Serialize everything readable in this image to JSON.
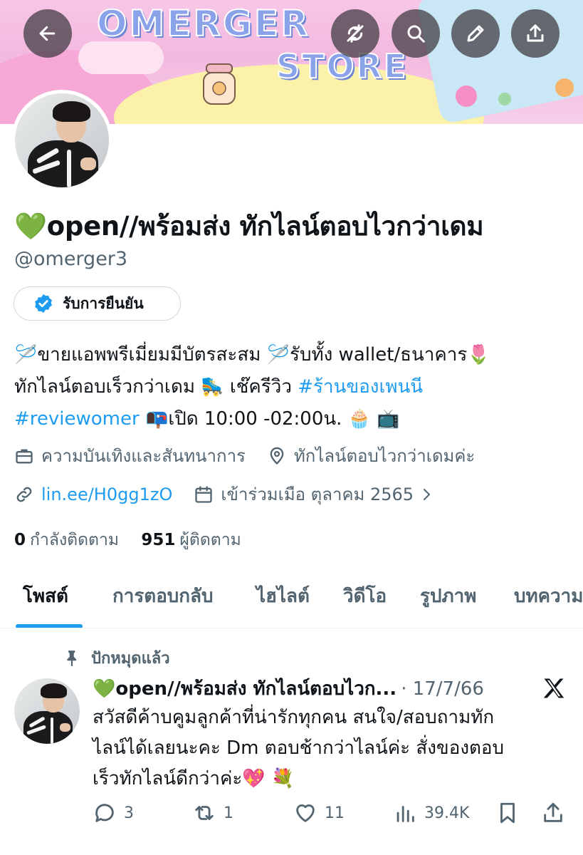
{
  "banner": {
    "title_line1": "OMERGER",
    "title_line2": "STORE"
  },
  "header_icons": {
    "back": "back-arrow-icon",
    "sync": "no-sync-icon",
    "search": "search-icon",
    "edit": "pencil-icon",
    "share": "share-icon"
  },
  "profile": {
    "display_name": "open//พร้อมส่ง ทักไลน์ตอบไวกว่าเดม",
    "name_emoji": "💚",
    "handle": "@omerger3",
    "verified_label": "รับการยืนยัน",
    "bio": {
      "line1_a": "ขายแอพพรีเมี่ยมมีบัตรสะสม ",
      "line1_b": "รับทั้ง wallet/ธนาคาร",
      "line1_emoji_needle": "🪡",
      "line1_emoji_tulip": "🌷",
      "line2_a": "ทักไลน์ตอบเร็วกว่าเดม ",
      "line2_emoji_skate": "🛼",
      "line2_b": " เช๊ครีวิว ",
      "line2_hashtag": "#ร้านของเพนนี",
      "line3_hashtag": "#reviewomer",
      "line3_emoji_mailbox": "📭",
      "line3_b": "เปิด 10:00 -02:00น. ",
      "line3_emoji_cupcake": "🧁",
      "line3_emoji_tv": "📺"
    },
    "category": "ความบันเทิงและสันทนาการ",
    "location": "ทักไลน์ตอบไวกว่าเดมค่ะ",
    "website": "lin.ee/H0gg1zO",
    "joined": "เข้าร่วมเมือ ตุลาคม 2565",
    "following_count": "0",
    "following_label": "กำลังติดตาม",
    "followers_count": "951",
    "followers_label": "ผู้ติดตาม"
  },
  "tabs": [
    {
      "label": "โพสต์",
      "active": true
    },
    {
      "label": "การตอบกลับ"
    },
    {
      "label": "ไฮไลต์"
    },
    {
      "label": "วิดีโอ"
    },
    {
      "label": "รูปภาพ"
    },
    {
      "label": "บทความ"
    }
  ],
  "pinned_post": {
    "pinned_label": "ปักหมุดแล้ว",
    "author": "open//พร้อมส่ง ทักไลน์ตอบไวก...",
    "author_emoji": "💚",
    "date": "· 17/7/66",
    "text_line1": "สวัสดีค้าบคูมลูกค้าที่น่ารักทุกคน สนใจ/สอบถามทัก",
    "text_line2": "ไลน์ได้เลยนะคะ Dm ตอบช้ากว่าไลน์ค่ะ สั่งของตอบ",
    "text_line3": "เร็วทักไลน์ดีกว่าค่ะ",
    "text_emoji_heart": "💖",
    "text_emoji_bouquet": "💐",
    "replies": "3",
    "reposts": "1",
    "likes": "11",
    "views": "39.4K"
  },
  "colors": {
    "accent": "#1d9bf0",
    "text_primary": "#0f1419",
    "text_secondary": "#536471",
    "border": "#cfd9de"
  }
}
